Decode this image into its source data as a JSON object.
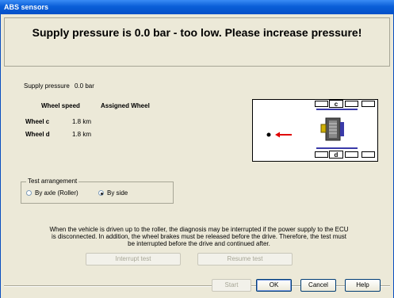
{
  "window": {
    "title": "ABS sensors"
  },
  "header": {
    "message": "Supply pressure is  0.0 bar - too low. Please increase pressure!"
  },
  "supply": {
    "label": "Supply pressure",
    "value": "0.0 bar"
  },
  "table": {
    "col_speed": "Wheel speed",
    "col_assigned": "Assigned Wheel",
    "rows": [
      {
        "wheel": "Wheel c",
        "speed": "1.8 km"
      },
      {
        "wheel": "Wheel d",
        "speed": "1.8 km"
      }
    ]
  },
  "diagram": {
    "label_c": "c",
    "label_d": "d",
    "arrow_color": "#e00000"
  },
  "test_arrangement": {
    "title": "Test arrangement",
    "options": [
      {
        "label": "By axle (Roller)",
        "selected": false
      },
      {
        "label": "By side",
        "selected": true
      }
    ]
  },
  "info_text": "When the vehicle is driven up to the roller, the diagnosis may be interrupted if the power supply to the ECU is disconnected. In addition, the wheel brakes must be released before the drive. Therefore, the test must be interrupted before the drive and continued after.",
  "buttons": {
    "interrupt": "Interrupt test",
    "resume": "Resume test",
    "start": "Start",
    "ok": "OK",
    "cancel": "Cancel",
    "help": "Help"
  }
}
